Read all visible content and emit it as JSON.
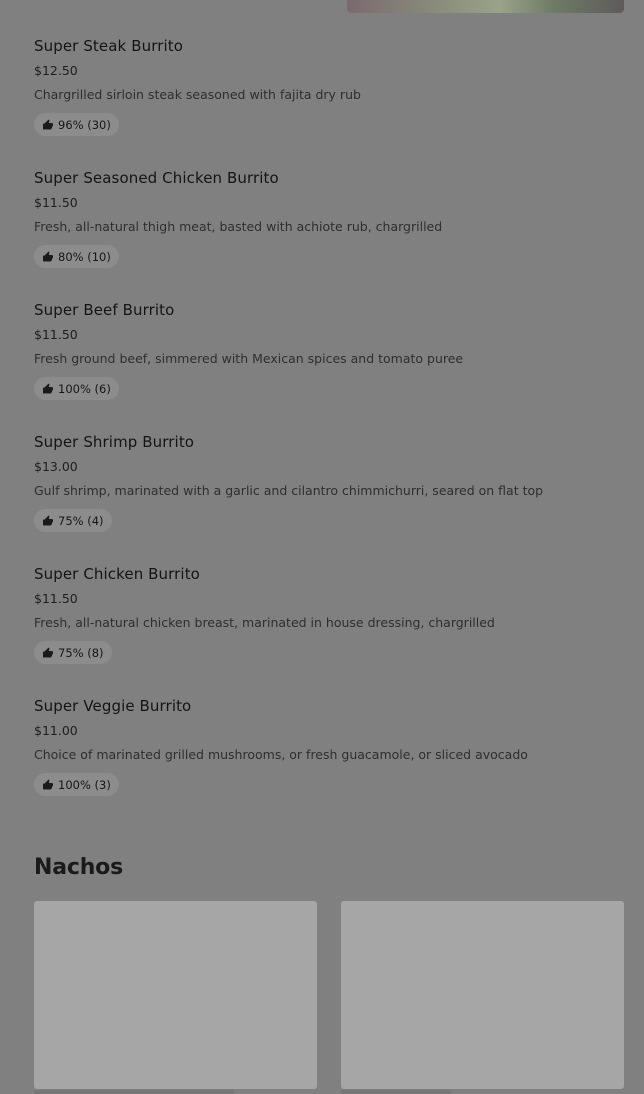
{
  "items": [
    {
      "name": "Super Steak Burrito",
      "price": "$12.50",
      "desc": "Chargrilled sirloin steak seasoned with fajita dry rub",
      "rating": "96% (30)"
    },
    {
      "name": "Super Seasoned Chicken Burrito",
      "price": "$11.50",
      "desc": "Fresh, all-natural thigh meat, basted with achiote rub, chargrilled",
      "rating": "80% (10)"
    },
    {
      "name": "Super Beef Burrito",
      "price": "$11.50",
      "desc": "Fresh ground beef, simmered with Mexican spices and tomato puree",
      "rating": "100% (6)"
    },
    {
      "name": "Super Shrimp Burrito",
      "price": "$13.00",
      "desc": "Gulf shrimp, marinated with a garlic and cilantro chimmichurri, seared on flat top",
      "rating": "75% (4)"
    },
    {
      "name": "Super Chicken Burrito",
      "price": "$11.50",
      "desc": "Fresh, all-natural chicken breast, marinated in house dressing, chargrilled",
      "rating": "75% (8)"
    },
    {
      "name": "Super Veggie Burrito",
      "price": "$11.00",
      "desc": "Choice of marinated grilled mushrooms, or fresh guacamole, or sliced avocado",
      "rating": "100% (3)"
    }
  ],
  "section": {
    "title": "Nachos"
  },
  "icons": {
    "rating": "thumbs-up-icon"
  }
}
